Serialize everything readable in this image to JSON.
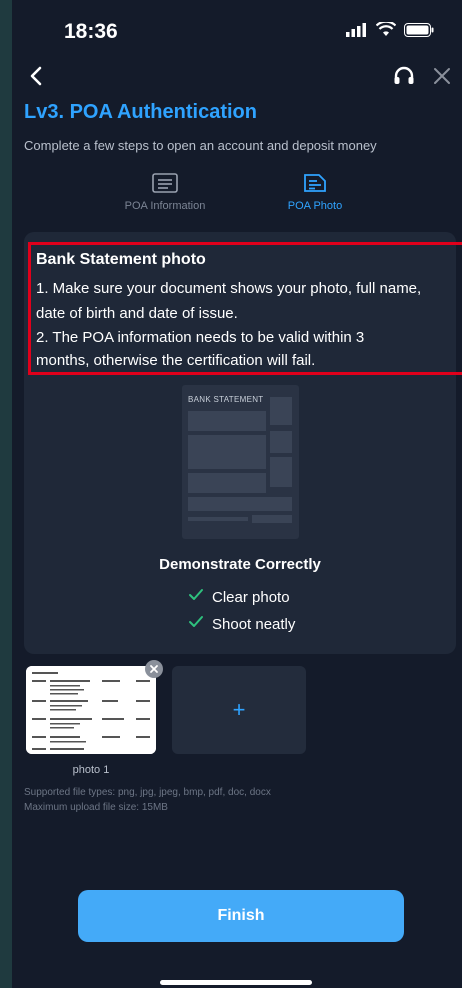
{
  "status_bar": {
    "time": "18:36"
  },
  "header": {
    "title": "Lv3. POA Authentication",
    "subtitle": "Complete a few steps to open an account and deposit money"
  },
  "steps": [
    {
      "label": "POA Information",
      "icon": "list-doc-icon",
      "active": false
    },
    {
      "label": "POA Photo",
      "icon": "photo-doc-icon",
      "active": true
    }
  ],
  "instructions": {
    "title": "Bank Statement photo",
    "lines": [
      "1. Make sure your document shows your photo, full name,",
      "date of birth and date of issue.",
      "2. The POA information needs to be valid within 3",
      "months, otherwise the certification will fail."
    ]
  },
  "sample": {
    "doc_heading": "BANK STATEMENT"
  },
  "demo": {
    "title": "Demonstrate Correctly",
    "checks": [
      "Clear photo",
      "Shoot neatly"
    ]
  },
  "upload": {
    "photo_label": "photo 1",
    "add_symbol": "+",
    "supported_types": "Supported file types: png, jpg, jpeg, bmp, pdf, doc, docx",
    "max_size": "Maximum upload file size: 15MB"
  },
  "actions": {
    "finish_label": "Finish"
  },
  "colors": {
    "accent": "#2fa3ff",
    "button": "#44aaf8",
    "background": "#141b2a",
    "highlight": "#e0001b"
  }
}
